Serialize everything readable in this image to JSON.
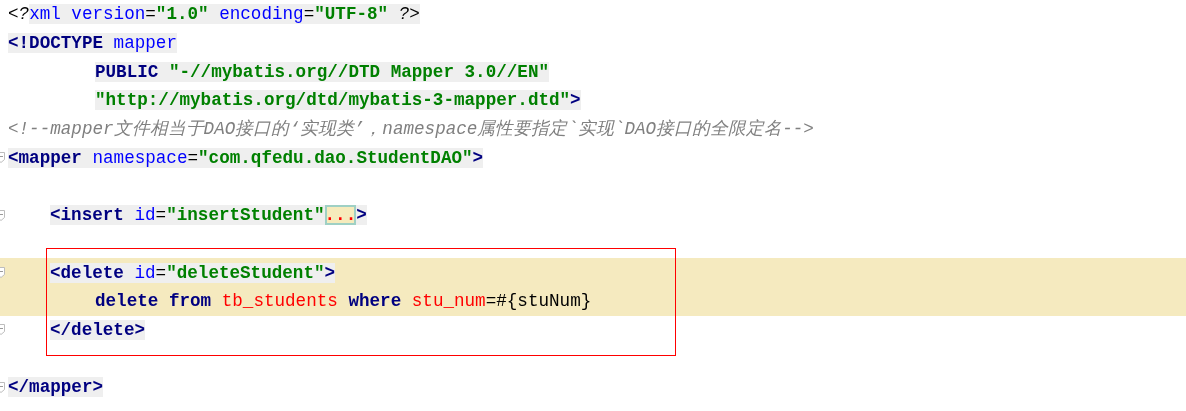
{
  "editor": {
    "lines": [
      {
        "kind": "top",
        "highlighted": false,
        "fold_marker": false,
        "groups": [
          {
            "shaded": false,
            "tokens": [
              {
                "t": "<?",
                "kind": "pi"
              }
            ]
          },
          {
            "shaded": true,
            "tokens": [
              {
                "t": "xml version",
                "kind": "attr"
              },
              {
                "t": "=",
                "kind": "plain"
              },
              {
                "t": "\"1.0\"",
                "kind": "str"
              },
              {
                "t": " encoding",
                "kind": "attr"
              },
              {
                "t": "=",
                "kind": "plain"
              },
              {
                "t": "\"UTF-8\"",
                "kind": "str"
              },
              {
                "t": " ?>",
                "kind": "pi"
              }
            ]
          }
        ]
      },
      {
        "kind": "top",
        "highlighted": false,
        "fold_marker": false,
        "groups": [
          {
            "shaded": true,
            "tokens": [
              {
                "t": "<!DOCTYPE",
                "kind": "tag"
              },
              {
                "t": " mapper",
                "kind": "attr"
              }
            ]
          }
        ]
      },
      {
        "kind": "continuation",
        "highlighted": false,
        "fold_marker": false,
        "groups": [
          {
            "shaded": true,
            "tokens": [
              {
                "t": "PUBLIC",
                "kind": "tag"
              },
              {
                "t": " \"-//mybatis.org//DTD Mapper 3.0//EN\"",
                "kind": "str"
              }
            ]
          }
        ]
      },
      {
        "kind": "continuation",
        "highlighted": false,
        "fold_marker": false,
        "groups": [
          {
            "shaded": true,
            "tokens": [
              {
                "t": "\"http://mybatis.org/dtd/mybatis-3-mapper.dtd\"",
                "kind": "str"
              },
              {
                "t": ">",
                "kind": "tag"
              }
            ]
          }
        ]
      },
      {
        "kind": "top",
        "highlighted": false,
        "fold_marker": false,
        "groups": [
          {
            "shaded": false,
            "tokens": [
              {
                "t": "<!--mapper文件相当于DAO接口的‘实现类’，namespace属性要指定`实现`DAO接口的全限定名-->",
                "kind": "comment"
              }
            ]
          }
        ]
      },
      {
        "kind": "top",
        "highlighted": false,
        "fold_marker": true,
        "groups": [
          {
            "shaded": true,
            "tokens": [
              {
                "t": "<mapper",
                "kind": "tag"
              },
              {
                "t": " namespace",
                "kind": "attr"
              },
              {
                "t": "=",
                "kind": "plain"
              },
              {
                "t": "\"com.qfedu.dao.StudentDAO\"",
                "kind": "str"
              },
              {
                "t": ">",
                "kind": "tag"
              }
            ]
          }
        ]
      },
      {
        "kind": "top",
        "highlighted": false,
        "fold_marker": false
      },
      {
        "kind": "nested",
        "highlighted": false,
        "fold_marker": true,
        "groups": [
          {
            "shaded": true,
            "tokens": [
              {
                "t": "<insert",
                "kind": "tag"
              },
              {
                "t": " id",
                "kind": "attr"
              },
              {
                "t": "=",
                "kind": "plain"
              },
              {
                "t": "\"insertStudent\"",
                "kind": "str"
              },
              {
                "t": "...",
                "kind": "fold"
              },
              {
                "t": ">",
                "kind": "tag"
              }
            ]
          }
        ]
      },
      {
        "kind": "top",
        "highlighted": false,
        "fold_marker": false
      },
      {
        "kind": "nested",
        "highlighted": true,
        "fold_marker": true,
        "groups": [
          {
            "shaded": true,
            "tokens": [
              {
                "t": "<delete",
                "kind": "tag"
              },
              {
                "t": " id",
                "kind": "attr"
              },
              {
                "t": "=",
                "kind": "plain"
              },
              {
                "t": "\"deleteStudent\"",
                "kind": "str"
              },
              {
                "t": ">",
                "kind": "tag"
              }
            ]
          }
        ]
      },
      {
        "kind": "continuation",
        "highlighted": true,
        "fold_marker": false,
        "groups": [
          {
            "shaded": false,
            "tokens": [
              {
                "t": "delete",
                "kind": "kw"
              },
              {
                "t": " from",
                "kind": "kw"
              },
              {
                "t": " tb_students",
                "kind": "ident"
              },
              {
                "t": " where",
                "kind": "kw"
              },
              {
                "t": " stu_num",
                "kind": "ident"
              },
              {
                "t": "=#{stuNum}",
                "kind": "plain"
              }
            ]
          }
        ]
      },
      {
        "kind": "nested",
        "highlighted": false,
        "fold_marker": true,
        "groups": [
          {
            "shaded": true,
            "tokens": [
              {
                "t": "</delete>",
                "kind": "tag"
              }
            ]
          }
        ]
      },
      {
        "kind": "top",
        "highlighted": false,
        "fold_marker": false
      },
      {
        "kind": "top",
        "highlighted": false,
        "fold_marker": true,
        "groups": [
          {
            "shaded": true,
            "tokens": [
              {
                "t": "</mapper>",
                "kind": "tag"
              }
            ]
          }
        ]
      }
    ]
  }
}
